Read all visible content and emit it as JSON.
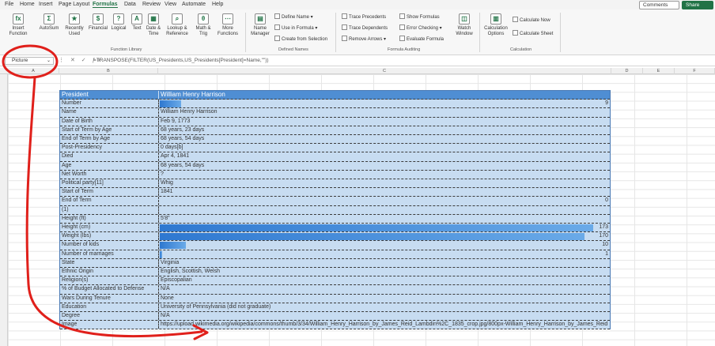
{
  "menu": [
    "File",
    "Home",
    "Insert",
    "Page Layout",
    "Formulas",
    "Data",
    "Review",
    "View",
    "Automate",
    "Help"
  ],
  "menu_active": "Formulas",
  "top_buttons": {
    "comments": "Comments",
    "share": "Share"
  },
  "ribbon": {
    "insert_function": "Insert Function",
    "autosum": "AutoSum",
    "recently_used": "Recently Used",
    "financial": "Financial",
    "logical": "Logical",
    "text": "Text",
    "date_time": "Date & Time",
    "lookup": "Lookup & Reference",
    "math": "Math & Trig",
    "more_functions": "More Functions",
    "function_library": "Function Library",
    "name_manager": "Name Manager",
    "define_name": "Define Name",
    "use_in_formula": "Use in Formula",
    "create_from_selection": "Create from Selection",
    "defined_names": "Defined Names",
    "trace_precedents": "Trace Precedents",
    "trace_dependents": "Trace Dependents",
    "remove_arrows": "Remove Arrows",
    "show_formulas": "Show Formulas",
    "error_checking": "Error Checking",
    "evaluate_formula": "Evaluate Formula",
    "formula_auditing": "Formula Auditing",
    "watch_window": "Watch Window",
    "calculation_options": "Calculation Options",
    "calculate_now": "Calculate Now",
    "calculate_sheet": "Calculate Sheet",
    "calculation": "Calculation"
  },
  "formula_bar": {
    "name_box": "Picture",
    "formula": "=TRANSPOSE(FILTER(US_Presidents,US_Presidents[President]=Name,\"\"))"
  },
  "columns": [
    "A",
    "B",
    "C",
    "D",
    "E",
    "F"
  ],
  "table": {
    "header": [
      "President",
      "William Henry Harrison"
    ],
    "rows": [
      {
        "label": "Number",
        "value": "",
        "num": "9",
        "bar": 0.05
      },
      {
        "label": "Name",
        "value": "William Henry Harrison"
      },
      {
        "label": "Date of Birth",
        "value": "Feb 9, 1773"
      },
      {
        "label": "Start of Term by Age",
        "value": "68 years, 23 days"
      },
      {
        "label": "End of Term by Age",
        "value": "68 years, 54 days"
      },
      {
        "label": "Post-Presidency",
        "value": "0 days[b]"
      },
      {
        "label": "Died",
        "value": "Apr 4, 1841"
      },
      {
        "label": "Age",
        "value": "68 years, 54 days"
      },
      {
        "label": "Net Worth",
        "value": "?"
      },
      {
        "label": "Political party[11]",
        "value": "Whig"
      },
      {
        "label": "Start of Term",
        "value": "1841"
      },
      {
        "label": "End of Term",
        "value": "",
        "num": "0"
      },
      {
        "label": "(1)",
        "value": ""
      },
      {
        "label": "Height (ft)",
        "value": "5'8\""
      },
      {
        "label": "Height (cm)",
        "value": "",
        "num": "173",
        "bar": 1.0
      },
      {
        "label": "Weight (lbs)",
        "value": "",
        "num": "170",
        "bar": 0.98
      },
      {
        "label": "Number of kids",
        "value": "",
        "num": "10",
        "bar": 0.06
      },
      {
        "label": "Number of marriages",
        "value": "",
        "num": "1",
        "bar": 0.006
      },
      {
        "label": "State",
        "value": "Virginia"
      },
      {
        "label": "Ethnic Origin",
        "value": "English, Scottish, Welsh"
      },
      {
        "label": "Religion(s)",
        "value": "Episcopalian"
      },
      {
        "label": "% of Budget Allocated to Defense",
        "value": "N/A"
      },
      {
        "label": "Wars During Tenure",
        "value": "None"
      },
      {
        "label": "Education",
        "value": "University of Pennsylvania (did not graduate)"
      },
      {
        "label": "Degree",
        "value": "N/A"
      },
      {
        "label": "Image",
        "value": "https://upload.wikimedia.org/wikipedia/commons/thumb/3/34/William_Henry_Harrison_by_James_Reid_Lambdin%2C_1835_crop.jpg/800px-William_Henry_Harrison_by_James_Reid_Lambdin%2C_1835"
      }
    ]
  },
  "colors": {
    "header_blue": "#4f8ed3",
    "row_blue": "#c7dcf1",
    "annotation_red": "#e0201b",
    "excel_green": "#217346"
  }
}
